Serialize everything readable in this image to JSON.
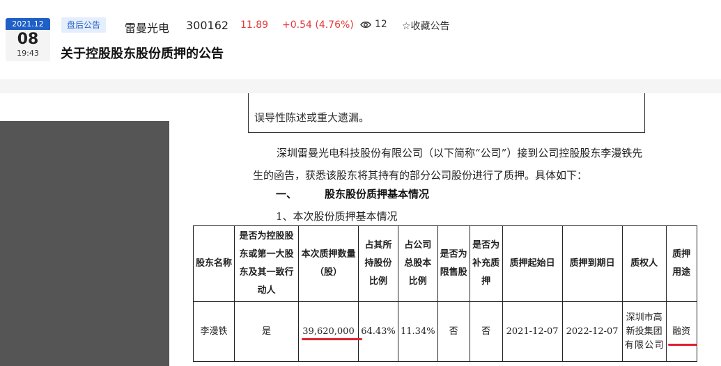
{
  "header": {
    "date": {
      "ym": "2021.12",
      "day": "08",
      "time": "19:43"
    },
    "tag": "盘后公告",
    "stock": {
      "name": "雷曼光电",
      "code": "300162",
      "price": "11.89",
      "change": "+0.54 (4.76%)"
    },
    "views": "12",
    "favorite_label": "☆收藏公告",
    "title": "关于控股股东股份质押的公告"
  },
  "document": {
    "prev_box_text": "误导性陈述或重大遗漏。",
    "intro": "深圳雷曼光电科技股份有限公司（以下简称“公司”）接到公司控股股东李漫铁先生的函告，获悉该股东将其持有的部分公司股份进行了质押。具体如下：",
    "section_num": "一、",
    "section_title": "股东股份质押基本情况",
    "sub_title": "1、本次股份质押基本情况",
    "table": {
      "headers": [
        "股东名称",
        "是否为控股股东或第一大股东及其一致行动人",
        "本次质押数量（股）",
        "占其所持股份比例",
        "占公司总股本比例",
        "是否为限售股",
        "是否为补充质押",
        "质押起始日",
        "质押到期日",
        "质权人",
        "质押用途"
      ],
      "row": {
        "holder": "李漫铁",
        "is_controlling": "是",
        "pledge_qty": "39,620,000",
        "pct_holding": "64.43%",
        "pct_total": "11.34%",
        "restricted": "否",
        "supplementary": "否",
        "start_date": "2021-12-07",
        "end_date": "2022-12-07",
        "pledgee": "深圳市高新投集团有限公司",
        "purpose": "融资"
      }
    }
  },
  "colors": {
    "accent_blue": "#1f5fc6",
    "up_red": "#e23a3a",
    "highlight_red": "#e0202e"
  },
  "icons": {
    "views": "eye-icon",
    "favorite": "star-outline-icon"
  }
}
